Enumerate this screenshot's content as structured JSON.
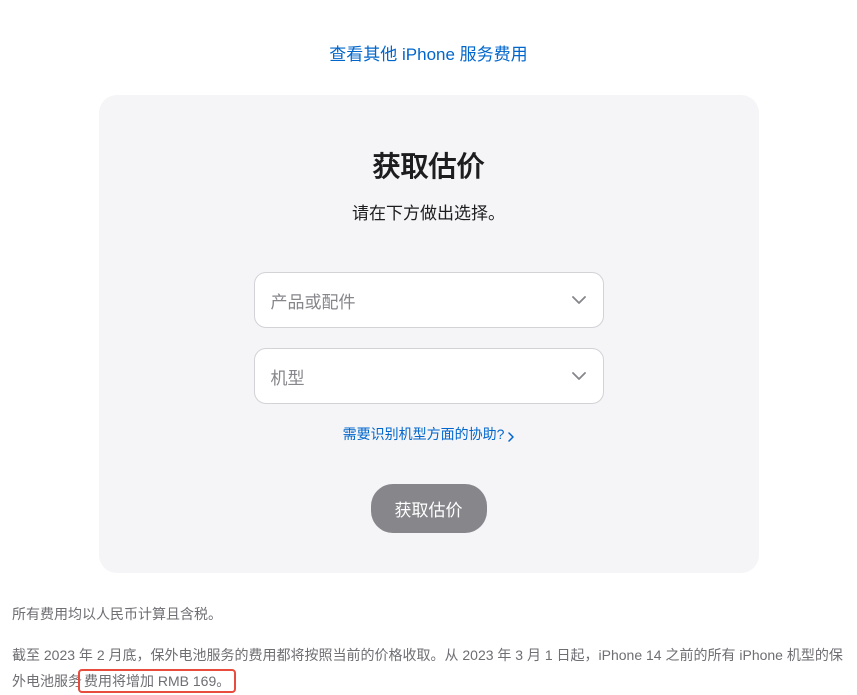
{
  "topLink": "查看其他 iPhone 服务费用",
  "card": {
    "title": "获取估价",
    "subtitle": "请在下方做出选择。",
    "select1Placeholder": "产品或配件",
    "select2Placeholder": "机型",
    "helpLink": "需要识别机型方面的协助?",
    "submitLabel": "获取估价"
  },
  "disclaimer": {
    "line1": "所有费用均以人民币计算且含税。",
    "line2_part1": "截至 2023 年 2 月底，保外电池服务的费用都将按照当前的价格收取。从 2023 年 3 月 1 日起，iPhone 14 之前的所有 iPhone 机型的保外电池服务",
    "line2_highlight": "费用将增加 RMB 169。"
  }
}
